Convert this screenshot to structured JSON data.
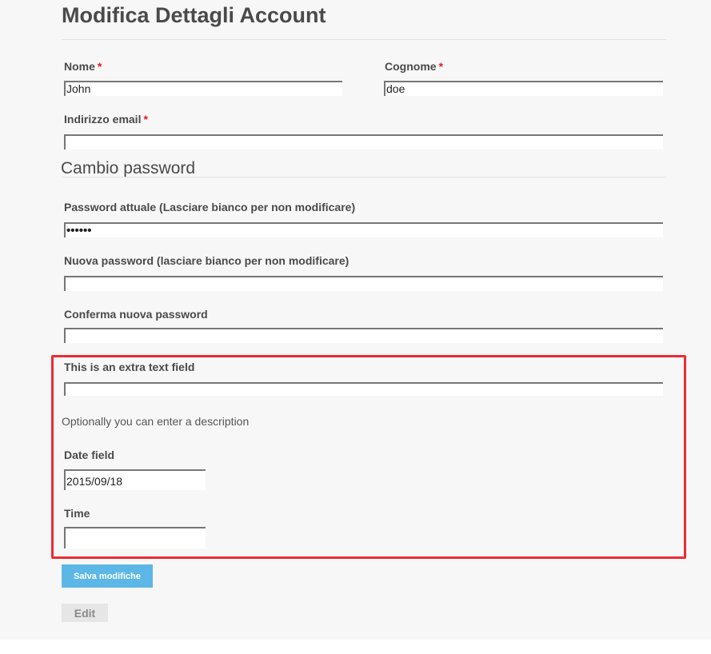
{
  "page": {
    "title": "Modifica Dettagli Account"
  },
  "form": {
    "first_name": {
      "label": "Nome",
      "required_mark": "*",
      "value": "John"
    },
    "last_name": {
      "label": "Cognome",
      "required_mark": "*",
      "value": "doe"
    },
    "email": {
      "label": "Indirizzo email",
      "required_mark": "*",
      "value": ""
    }
  },
  "password_section": {
    "title": "Cambio password",
    "current": {
      "label": "Password attuale (Lasciare bianco per non modificare)",
      "value": "••••••"
    },
    "new": {
      "label": "Nuova password (lasciare bianco per non modificare)",
      "value": ""
    },
    "confirm": {
      "label": "Conferma nuova password",
      "value": ""
    }
  },
  "extra_fields": {
    "text_field": {
      "label": "This is an extra text field",
      "value": "",
      "description": "Optionally you can enter a description"
    },
    "date_field": {
      "label": "Date field",
      "value": "2015/09/18"
    },
    "time_field": {
      "label": "Time",
      "value": ""
    }
  },
  "actions": {
    "save_label": "Salva modifiche",
    "edit_label": "Edit"
  },
  "colors": {
    "required": "#e8191d",
    "highlight_border": "#ee2a33",
    "save_button": "#5cb7e6",
    "edit_button": "#e6e6e6",
    "page_background": "#f7f7f7"
  }
}
